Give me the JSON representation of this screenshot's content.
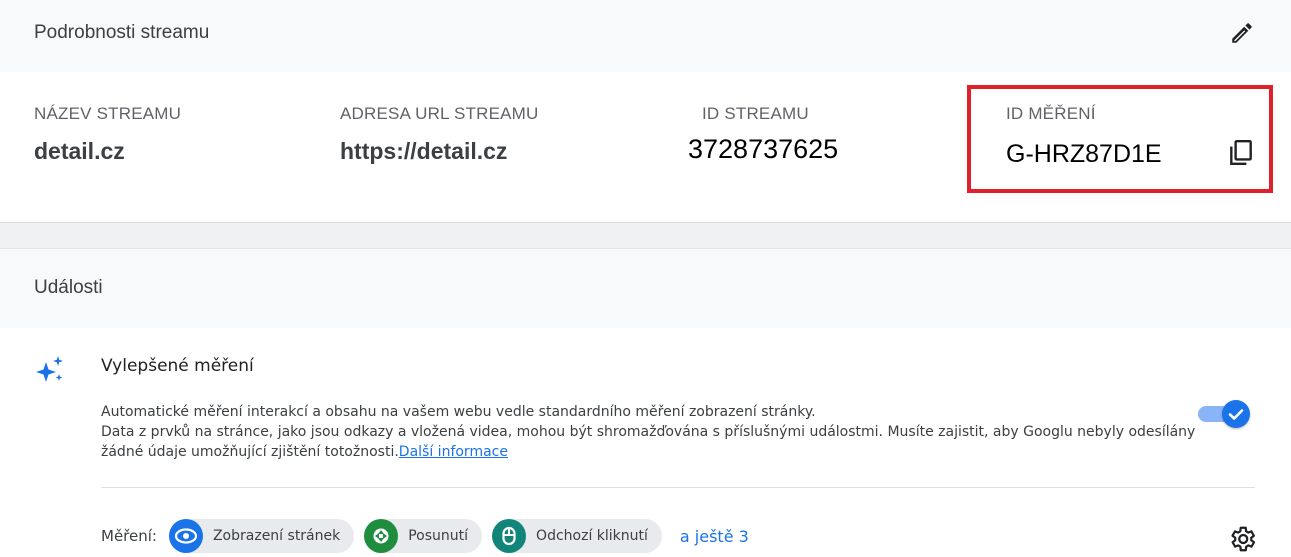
{
  "stream_details": {
    "title": "Podrobnosti streamu",
    "fields": {
      "name_label": "NÁZEV STREAMU",
      "name_value": "detail.cz",
      "url_label": "ADRESA URL STREAMU",
      "url_value": "https://detail.cz",
      "id_label": "ID STREAMU",
      "id_value": "3728737625",
      "measurement_label": "ID MĚŘENÍ",
      "measurement_value": "G-HRZ87D1E"
    },
    "highlight_color": "#e0212b"
  },
  "events": {
    "title": "Události",
    "enhanced": {
      "title": "Vylepšené měření",
      "desc_line1": "Automatické měření interakcí a obsahu na vašem webu vedle standardního měření zobrazení stránky.",
      "desc_line2": "Data z prvků na stránce, jako jsou odkazy a vložená videa, mohou být shromažďována s příslušnými událostmi. Musíte zajistit, aby Googlu nebyly odesílány žádné údaje umožňující zjištění totožnosti.",
      "learn_more": "Další informace",
      "toggle_on": true
    },
    "measurement": {
      "label": "Měření:",
      "chips": [
        {
          "label": "Zobrazení stránek",
          "icon": "eye-icon",
          "color": "#1a73e8"
        },
        {
          "label": "Posunutí",
          "icon": "scroll-arrows-icon",
          "color": "#1e8e3e"
        },
        {
          "label": "Odchozí kliknutí",
          "icon": "mouse-icon",
          "color": "#12857a"
        }
      ],
      "more": "a ještě 3"
    }
  },
  "accent_color": "#1a73e8"
}
